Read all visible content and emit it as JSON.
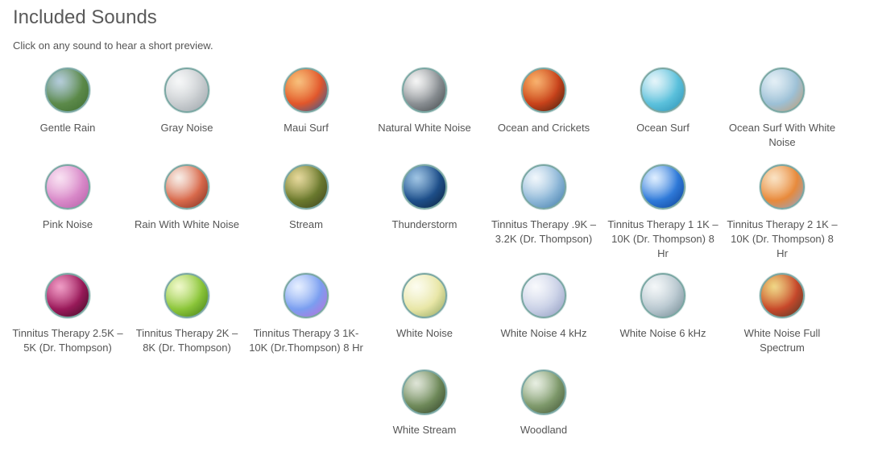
{
  "header": {
    "title": "Included Sounds",
    "subtitle": "Click on any sound to hear a short preview."
  },
  "sounds": [
    {
      "label": "Gentle Rain",
      "icon": "rain-landscape-icon",
      "colors": [
        "#8fb3c9",
        "#5c8a4a",
        "#3d6b2f"
      ]
    },
    {
      "label": "Gray Noise",
      "icon": "snowy-trees-icon",
      "colors": [
        "#f2f4f5",
        "#c9cdd0",
        "#9aa2a8"
      ]
    },
    {
      "label": "Maui Surf",
      "icon": "sunset-sea-icon",
      "colors": [
        "#f4a03a",
        "#e2562a",
        "#1f5fa8"
      ]
    },
    {
      "label": "Natural White Noise",
      "icon": "waterfall-icon",
      "colors": [
        "#f1f1f1",
        "#8a8f93",
        "#3f4447"
      ]
    },
    {
      "label": "Ocean and Crickets",
      "icon": "orange-sunset-icon",
      "colors": [
        "#f58a24",
        "#c8421a",
        "#3a1e10"
      ]
    },
    {
      "label": "Ocean Surf",
      "icon": "palm-beach-icon",
      "colors": [
        "#d9f0f7",
        "#5cc1dc",
        "#2a8fb4"
      ]
    },
    {
      "label": "Ocean Surf With White Noise",
      "icon": "seashell-beach-icon",
      "colors": [
        "#d6e7f1",
        "#9cc0d6",
        "#c69a6a"
      ]
    },
    {
      "label": "Pink Noise",
      "icon": "pink-flower-icon",
      "colors": [
        "#f6d3ec",
        "#d98ac9",
        "#b45aa6"
      ]
    },
    {
      "label": "Rain With White Noise",
      "icon": "rain-drops-icon",
      "colors": [
        "#f4e6dc",
        "#d96a4c",
        "#7a2a1e"
      ]
    },
    {
      "label": "Stream",
      "icon": "stream-rocks-icon",
      "colors": [
        "#d9c56a",
        "#6b7a2e",
        "#3a3f1c"
      ]
    },
    {
      "label": "Thunderstorm",
      "icon": "lightning-icon",
      "colors": [
        "#6fa7d6",
        "#1e4f8a",
        "#0b1f3a"
      ]
    },
    {
      "label": "Tinnitus Therapy .9K – 3.2K (Dr. Thompson)",
      "icon": "water-ripple-icon",
      "colors": [
        "#eaf3fa",
        "#8fb8d8",
        "#3d79a8"
      ]
    },
    {
      "label": "Tinnitus Therapy 1 1K – 10K (Dr. Thompson) 8 Hr",
      "icon": "blue-light-icon",
      "colors": [
        "#cfe6ff",
        "#2f7ad9",
        "#0b3d91"
      ]
    },
    {
      "label": "Tinnitus Therapy 2 1K – 10K (Dr. Thompson) 8 Hr",
      "icon": "orange-waves-icon",
      "colors": [
        "#f7d4a6",
        "#e8893a",
        "#8aa8d6"
      ]
    },
    {
      "label": "Tinnitus Therapy 2.5K – 5K (Dr. Thompson)",
      "icon": "magenta-waves-icon",
      "colors": [
        "#e86aa8",
        "#9a1a5a",
        "#3a0a22"
      ]
    },
    {
      "label": "Tinnitus Therapy 2K – 8K (Dr. Thompson)",
      "icon": "green-leaf-icon",
      "colors": [
        "#e8f5b0",
        "#8cc63a",
        "#3e7a14"
      ]
    },
    {
      "label": "Tinnitus Therapy 3 1K-10K (Dr.Thompson) 8 Hr",
      "icon": "bokeh-bubbles-icon",
      "colors": [
        "#d9e7ff",
        "#7a9ef0",
        "#c26ad9"
      ]
    },
    {
      "label": "White Noise",
      "icon": "white-flower-icon",
      "colors": [
        "#fbfbe8",
        "#e8e6a6",
        "#8aa05a"
      ]
    },
    {
      "label": "White Noise 4 kHz",
      "icon": "silk-fabric-icon",
      "colors": [
        "#f4f6fb",
        "#c9d0e6",
        "#8d98bd"
      ]
    },
    {
      "label": "White Noise 6 kHz",
      "icon": "glass-dome-icon",
      "colors": [
        "#eef3f5",
        "#b8c7cf",
        "#6f868f"
      ]
    },
    {
      "label": "White Noise Full Spectrum",
      "icon": "colorful-beads-icon",
      "colors": [
        "#e8c24a",
        "#c7482a",
        "#4a3a2a"
      ]
    },
    {
      "label": "White Stream",
      "icon": "forest-stream-icon",
      "colors": [
        "#cfd8c4",
        "#6f8a5a",
        "#2f3f28"
      ]
    },
    {
      "label": "Woodland",
      "icon": "woodland-path-icon",
      "colors": [
        "#dde7d5",
        "#7f9a6c",
        "#3f5234"
      ]
    }
  ]
}
